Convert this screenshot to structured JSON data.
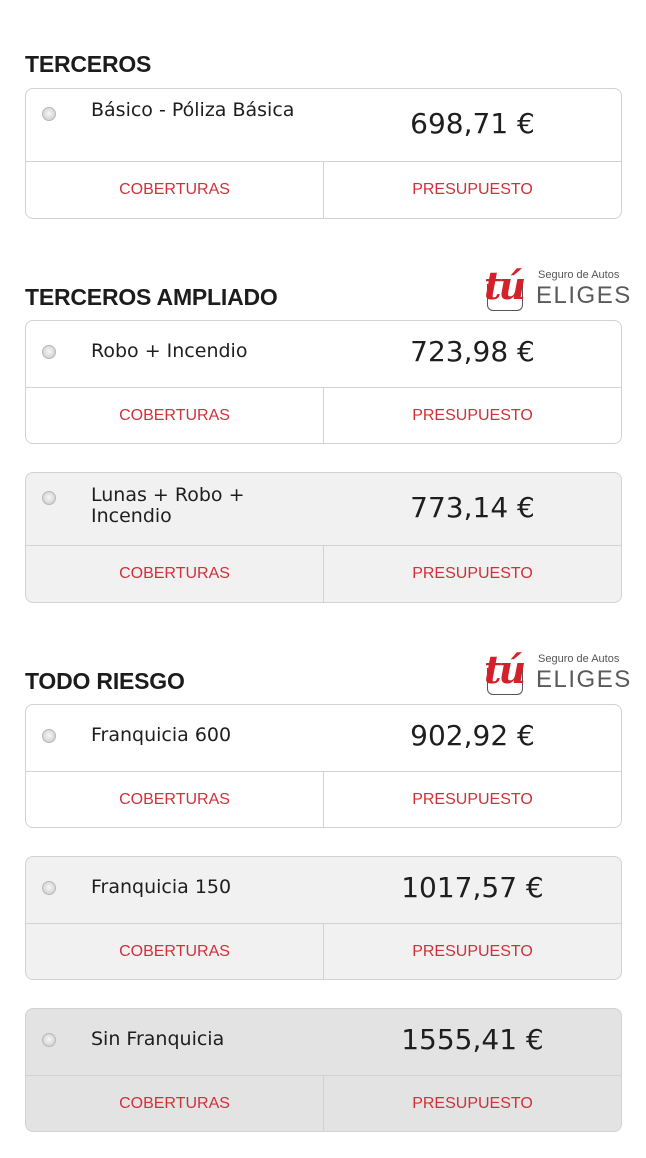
{
  "sections": [
    {
      "title": "TERCEROS",
      "logo": false
    },
    {
      "title": "TERCEROS AMPLIADO",
      "logo": true
    },
    {
      "title": "TODO RIESGO",
      "logo": true
    }
  ],
  "logo": {
    "mark": "tú",
    "tagline": "Seguro de Autos",
    "brand": "ELIGES"
  },
  "plans": [
    {
      "name": "Básico - Póliza Básica",
      "price": "698,71 €",
      "coverage_label": "COBERTURAS",
      "quote_label": "PRESUPUESTO"
    },
    {
      "name": "Robo + Incendio",
      "price": "723,98 €",
      "coverage_label": "COBERTURAS",
      "quote_label": "PRESUPUESTO"
    },
    {
      "name": "Lunas + Robo + Incendio",
      "price": "773,14 €",
      "coverage_label": "COBERTURAS",
      "quote_label": "PRESUPUESTO"
    },
    {
      "name": "Franquicia 600",
      "price": "902,92 €",
      "coverage_label": "COBERTURAS",
      "quote_label": "PRESUPUESTO"
    },
    {
      "name": "Franquicia 150",
      "price": "1017,57 €",
      "coverage_label": "COBERTURAS",
      "quote_label": "PRESUPUESTO"
    },
    {
      "name": "Sin Franquicia",
      "price": "1555,41 €",
      "coverage_label": "COBERTURAS",
      "quote_label": "PRESUPUESTO"
    }
  ],
  "colors": {
    "accent": "#d0303a",
    "brand_red": "#d4202a",
    "border": "#d2d2d2"
  }
}
